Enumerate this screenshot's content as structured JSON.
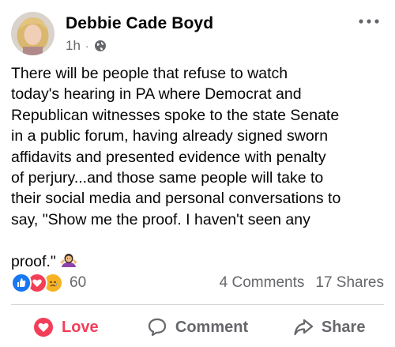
{
  "post": {
    "author": "Debbie Cade Boyd",
    "time": "1h",
    "separator": "·",
    "privacy_icon": "globe-icon",
    "more_icon": "more-horizontal-icon",
    "text": "There will be people that refuse to watch\ntoday's hearing in PA where Democrat and\nRepublican witnesses spoke to the state Senate\nin a public forum, having already signed sworn\naffidavits and presented evidence with penalty\nof perjury...and those same people will take to\ntheir social media and personal conversations to\nsay, \"Show me the proof. I haven't seen any\n\nproof.\"",
    "emoji": "woman-shrugging-emoji"
  },
  "engagement": {
    "reaction_icons": [
      "like-reaction-icon",
      "love-reaction-icon",
      "sad-reaction-icon"
    ],
    "reaction_count": "60",
    "comments": "4 Comments",
    "shares": "17 Shares"
  },
  "actions": {
    "love_label": "Love",
    "comment_label": "Comment",
    "share_label": "Share"
  },
  "colors": {
    "love": "#f33e58",
    "like": "#1877f2",
    "sad": "#f7b125",
    "secondary_text": "#65676b"
  }
}
